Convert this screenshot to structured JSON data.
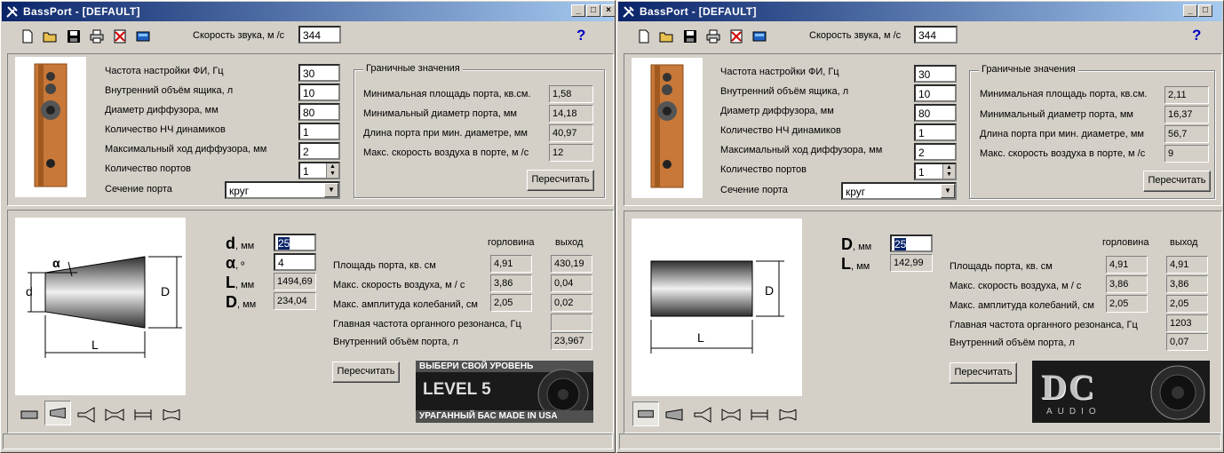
{
  "windows": [
    {
      "title": "BassPort - [DEFAULT]",
      "sound_speed_label": "Скорость звука, м /с",
      "sound_speed_value": "344",
      "help_label": "?",
      "params": [
        {
          "label": "Частота настройки ФИ, Гц",
          "value": "30"
        },
        {
          "label": "Внутренний объём ящика, л",
          "value": "10"
        },
        {
          "label": "Диаметр диффузора, мм",
          "value": "80"
        },
        {
          "label": "Количество НЧ динамиков",
          "value": "1"
        },
        {
          "label": "Максимальный ход диффузора, мм",
          "value": "2"
        },
        {
          "label": "Количество портов",
          "value": "1"
        }
      ],
      "section_label": "Сечение порта",
      "section_value": "круг",
      "limits": {
        "title": "Граничные значения",
        "rows": [
          {
            "label": "Минимальная площадь порта, кв.см.",
            "value": "1,58"
          },
          {
            "label": "Минимальный диаметр порта, мм",
            "value": "14,18"
          },
          {
            "label": "Длина порта при мин. диаметре, мм",
            "value": "40,97"
          },
          {
            "label": "Макс. скорость воздуха в порте, м /с",
            "value": "12"
          }
        ],
        "recalc": "Пересчитать"
      },
      "dims": [
        {
          "sym": "d",
          "unit": ", мм",
          "value": "25",
          "editable": true,
          "selected": true
        },
        {
          "sym": "α",
          "unit": ", º",
          "value": "4",
          "editable": true,
          "selected": false
        },
        {
          "sym": "L",
          "unit": ", мм",
          "value": "1494,69",
          "editable": false,
          "selected": false
        },
        {
          "sym": "D",
          "unit": ", мм",
          "value": "234,04",
          "editable": false,
          "selected": false
        }
      ],
      "results": {
        "col_throat": "горловина",
        "col_exit": "выход",
        "rows": [
          {
            "label": "Площадь порта, кв. см",
            "throat": "4,91",
            "exit": "430,19"
          },
          {
            "label": "Макс. скорость воздуха, м / с",
            "throat": "3,86",
            "exit": "0,04"
          },
          {
            "label": "Макс. амплитуда колебаний, см",
            "throat": "2,05",
            "exit": "0,02"
          },
          {
            "label": "Главная частота органного резонанса, Гц",
            "throat": "",
            "exit": ""
          },
          {
            "label": "Внутренний объём порта, л",
            "throat": "",
            "exit": "23,967"
          }
        ],
        "recalc": "Пересчитать"
      },
      "diagram": {
        "d": "d",
        "D": "D",
        "L": "L",
        "alpha": "α"
      },
      "banner": {
        "top": "ВЫБЕРИ СВОЙ УРОВЕНЬ",
        "mid": "LEVEL 5",
        "bottom": "УРАГАННЫЙ БАС MADE IN USA"
      }
    },
    {
      "title": "BassPort - [DEFAULT]",
      "sound_speed_label": "Скорость звука, м /с",
      "sound_speed_value": "344",
      "help_label": "?",
      "params": [
        {
          "label": "Частота настройки ФИ, Гц",
          "value": "30"
        },
        {
          "label": "Внутренний объём ящика, л",
          "value": "10"
        },
        {
          "label": "Диаметр диффузора, мм",
          "value": "80"
        },
        {
          "label": "Количество НЧ динамиков",
          "value": "1"
        },
        {
          "label": "Максимальный ход диффузора, мм",
          "value": "2"
        },
        {
          "label": "Количество портов",
          "value": "1"
        }
      ],
      "section_label": "Сечение порта",
      "section_value": "круг",
      "limits": {
        "title": "Граничные значения",
        "rows": [
          {
            "label": "Минимальная площадь порта, кв.см.",
            "value": "2,11"
          },
          {
            "label": "Минимальный диаметр порта, мм",
            "value": "16,37"
          },
          {
            "label": "Длина порта при мин. диаметре, мм",
            "value": "56,7"
          },
          {
            "label": "Макс. скорость воздуха в порте, м /с",
            "value": "9"
          }
        ],
        "recalc": "Пересчитать"
      },
      "dims": [
        {
          "sym": "D",
          "unit": ", мм",
          "value": "25",
          "editable": true,
          "selected": true
        },
        {
          "sym": "L",
          "unit": ", мм",
          "value": "142,99",
          "editable": false,
          "selected": false
        }
      ],
      "results": {
        "col_throat": "горловина",
        "col_exit": "выход",
        "rows": [
          {
            "label": "Площадь порта, кв. см",
            "throat": "4,91",
            "exit": "4,91"
          },
          {
            "label": "Макс. скорость воздуха, м / с",
            "throat": "3,86",
            "exit": "3,86"
          },
          {
            "label": "Макс. амплитуда колебаний, см",
            "throat": "2,05",
            "exit": "2,05"
          },
          {
            "label": "Главная частота органного резонанса, Гц",
            "throat": "",
            "exit": "1203"
          },
          {
            "label": "Внутренний объём порта, л",
            "throat": "",
            "exit": "0,07"
          }
        ],
        "recalc": "Пересчитать"
      },
      "diagram": {
        "D": "D",
        "L": "L"
      },
      "banner": {
        "logo": "DC",
        "sub": "AUDIO"
      }
    }
  ]
}
